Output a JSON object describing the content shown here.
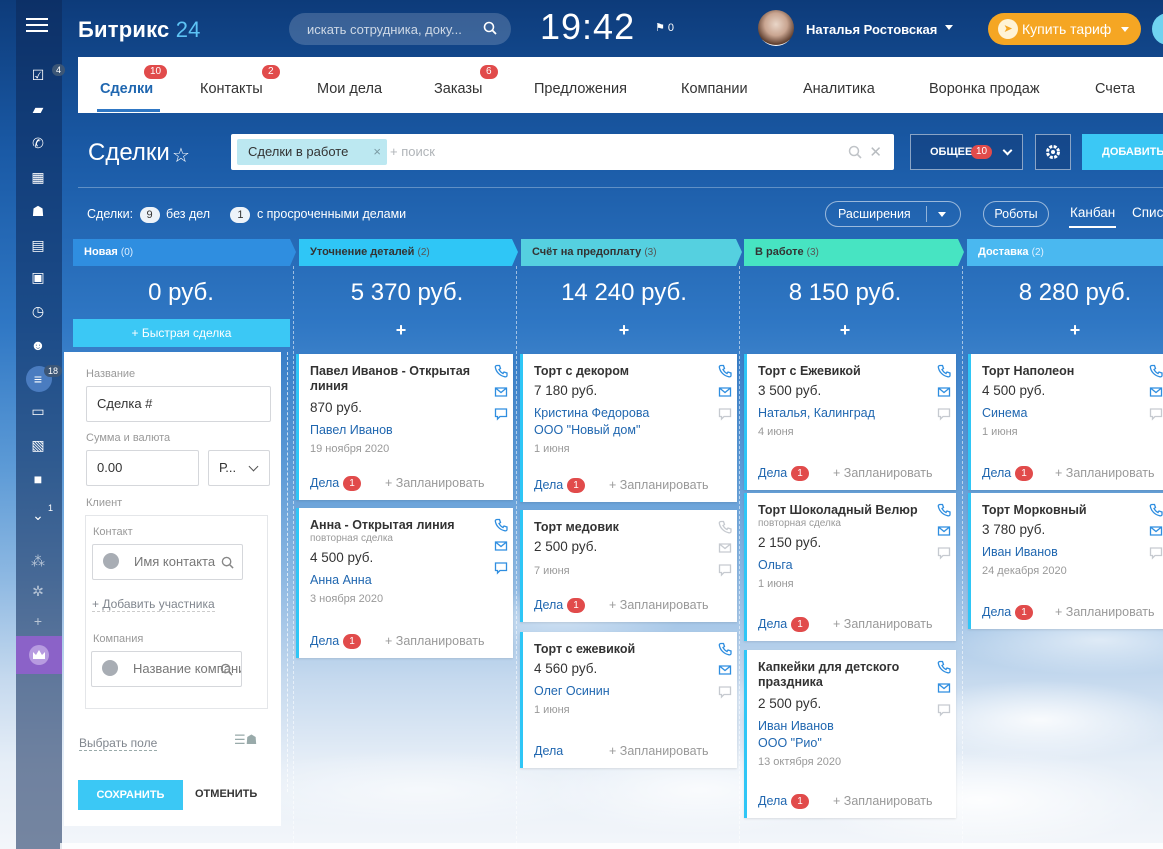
{
  "app": {
    "brand": "Битрикс",
    "brand_num": "24",
    "time": "19:42",
    "flag_count": "0"
  },
  "search": {
    "placeholder": "искать сотрудника, доку..."
  },
  "user": {
    "name": "Наталья Ростовская"
  },
  "buy_button": "Купить тариф",
  "rail": {
    "badges": {
      "tasks": "4",
      "filter": "18",
      "down": "1"
    }
  },
  "tabs": [
    {
      "label": "Сделки",
      "badge": "10"
    },
    {
      "label": "Контакты",
      "badge": "2"
    },
    {
      "label": "Мои дела",
      "badge": ""
    },
    {
      "label": "Заказы",
      "badge": "6"
    },
    {
      "label": "Предложения",
      "badge": ""
    },
    {
      "label": "Компании",
      "badge": ""
    },
    {
      "label": "Аналитика",
      "badge": ""
    },
    {
      "label": "Воронка продаж",
      "badge": ""
    },
    {
      "label": "Счета",
      "badge": ""
    }
  ],
  "toolbar": {
    "title": "Сделки",
    "filter_chip": "Сделки в работе",
    "filter_placeholder": "+ поиск",
    "general_label": "ОБЩЕЕ",
    "general_badge": "10",
    "add_label": "ДОБАВИТЬ"
  },
  "info": {
    "deals_label": "Сделки:",
    "no_tasks_count": "9",
    "no_tasks_label": "без дел",
    "overdue_count": "1",
    "overdue_label": "с просроченными делами"
  },
  "view": {
    "extensions": "Расширения",
    "robots": "Роботы",
    "kanban": "Канбан",
    "list": "Список"
  },
  "quick_deal": "+ Быстрая сделка",
  "form": {
    "name_label": "Название",
    "name_value": "Сделка #",
    "sum_label": "Сумма и валюта",
    "sum_value": "0.00",
    "currency_value": "Р...",
    "client_label": "Клиент",
    "contact_label": "Контакт",
    "contact_placeholder": "Имя контакта",
    "add_participant": "+ Добавить участника",
    "company_label": "Компания",
    "company_placeholder": "Название компании",
    "pick_field": "Выбрать поле",
    "save": "СОХРАНИТЬ",
    "cancel": "ОТМЕНИТЬ"
  },
  "colors": {
    "accent": "#3bc8f5",
    "badge": "#e14b4b",
    "link": "#2067b0",
    "stage_new": "#2f8ee0",
    "stage_detail": "#2fc6f6",
    "stage_invoice": "#55d0e0",
    "stage_work": "#47e4c2",
    "stage_delivery": "#4ab8f0"
  },
  "columns": [
    {
      "title": "Новая",
      "count": "(0)",
      "total": "0 руб.",
      "cards": []
    },
    {
      "title": "Уточнение деталей",
      "count": "(2)",
      "total": "5 370 руб.",
      "cards": [
        {
          "title": "Павел Иванов - Открытая линия",
          "repeat": "",
          "price": "870 руб.",
          "links": [
            "Павел Иванов"
          ],
          "date": "19 ноября 2020",
          "tasks": "Дела",
          "badge": "1",
          "plan": "+ Запланировать"
        },
        {
          "title": "Анна - Открытая линия",
          "repeat": "повторная сделка",
          "price": "4 500 руб.",
          "links": [
            "Анна Анна"
          ],
          "date": "3 ноября 2020",
          "tasks": "Дела",
          "badge": "1",
          "plan": "+ Запланировать"
        }
      ]
    },
    {
      "title": "Счёт на предоплату",
      "count": "(3)",
      "total": "14 240 руб.",
      "cards": [
        {
          "title": "Торт с декором",
          "repeat": "",
          "price": "7 180 руб.",
          "links": [
            "Кристина Федорова",
            "ООО \"Новый дом\""
          ],
          "date": "1 июня",
          "tasks": "Дела",
          "badge": "1",
          "plan": "+ Запланировать"
        },
        {
          "title": "Торт медовик",
          "repeat": "",
          "price": "2 500 руб.",
          "links": [],
          "date": "7 июня",
          "tasks": "Дела",
          "badge": "1",
          "plan": "+ Запланировать"
        },
        {
          "title": "Торт с ежевикой",
          "repeat": "",
          "price": "4 560 руб.",
          "links": [
            "Олег Осинин"
          ],
          "date": "1 июня",
          "tasks": "Дела",
          "badge": "",
          "plan": "+ Запланировать"
        }
      ]
    },
    {
      "title": "В работе",
      "count": "(3)",
      "total": "8 150 руб.",
      "cards": [
        {
          "title": "Торт с Ежевикой",
          "repeat": "",
          "price": "3 500 руб.",
          "links": [
            "Наталья, Калинград"
          ],
          "date": "4 июня",
          "tasks": "Дела",
          "badge": "1",
          "plan": "+ Запланировать"
        },
        {
          "title": "Торт Шоколадный Велюр",
          "repeat": "повторная сделка",
          "price": "2 150 руб.",
          "links": [
            "Ольга"
          ],
          "date": "1 июня",
          "tasks": "Дела",
          "badge": "1",
          "plan": "+ Запланировать"
        },
        {
          "title": "Капкейки для детского праздника",
          "repeat": "",
          "price": "2 500 руб.",
          "links": [
            "Иван Иванов",
            "ООО \"Рио\""
          ],
          "date": "13 октября 2020",
          "tasks": "Дела",
          "badge": "1",
          "plan": "+ Запланировать"
        }
      ]
    },
    {
      "title": "Доставка",
      "count": "(2)",
      "total": "8 280 руб.",
      "cards": [
        {
          "title": "Торт Наполеон",
          "repeat": "",
          "price": "4 500 руб.",
          "links": [
            "Синема"
          ],
          "date": "1 июня",
          "tasks": "Дела",
          "badge": "1",
          "plan": "+ Запланировать"
        },
        {
          "title": "Торт Морковный",
          "repeat": "",
          "price": "3 780 руб.",
          "links": [
            "Иван Иванов"
          ],
          "date": "24 декабря 2020",
          "tasks": "Дела",
          "badge": "1",
          "plan": "+ Запланировать"
        }
      ]
    }
  ]
}
